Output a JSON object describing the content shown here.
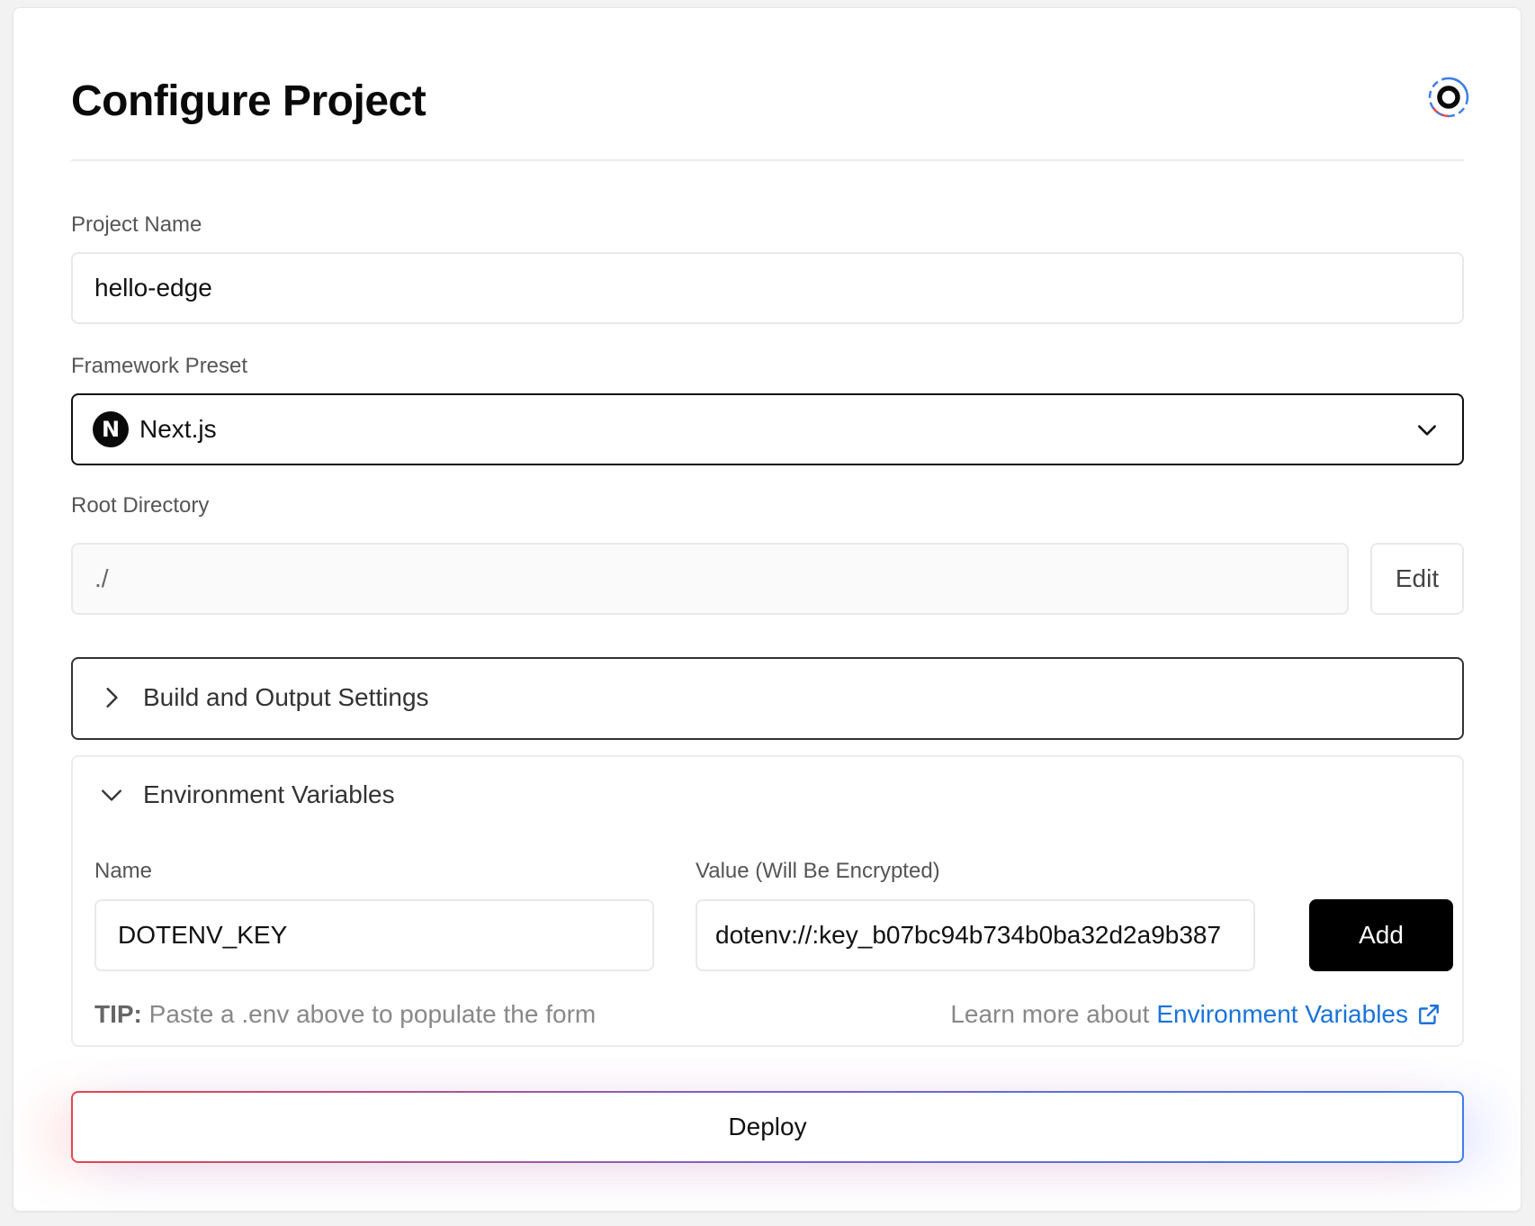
{
  "header": {
    "title": "Configure Project",
    "brand_icon": "circle-logo-icon"
  },
  "project_name": {
    "label": "Project Name",
    "value": "hello-edge"
  },
  "framework": {
    "label": "Framework Preset",
    "icon_letter": "N",
    "value": "Next.js"
  },
  "root_directory": {
    "label": "Root Directory",
    "value": "./",
    "edit_label": "Edit"
  },
  "build_settings": {
    "label": "Build and Output Settings"
  },
  "env": {
    "label": "Environment Variables",
    "name_label": "Name",
    "name_value": "DOTENV_KEY",
    "value_label": "Value (Will Be Encrypted)",
    "value_value": "dotenv://:key_b07bc94b734b0ba32d2a9b387",
    "add_label": "Add",
    "tip_prefix": "TIP:",
    "tip_text": " Paste a .env above to populate the form",
    "learn_prefix": "Learn more about",
    "learn_link": "Environment Variables"
  },
  "deploy": {
    "label": "Deploy"
  },
  "colors": {
    "link": "#1a73d9",
    "deploy_gradient_start": "#e0484f",
    "deploy_gradient_end": "#3f7ee8",
    "primary_button": "#000000"
  }
}
